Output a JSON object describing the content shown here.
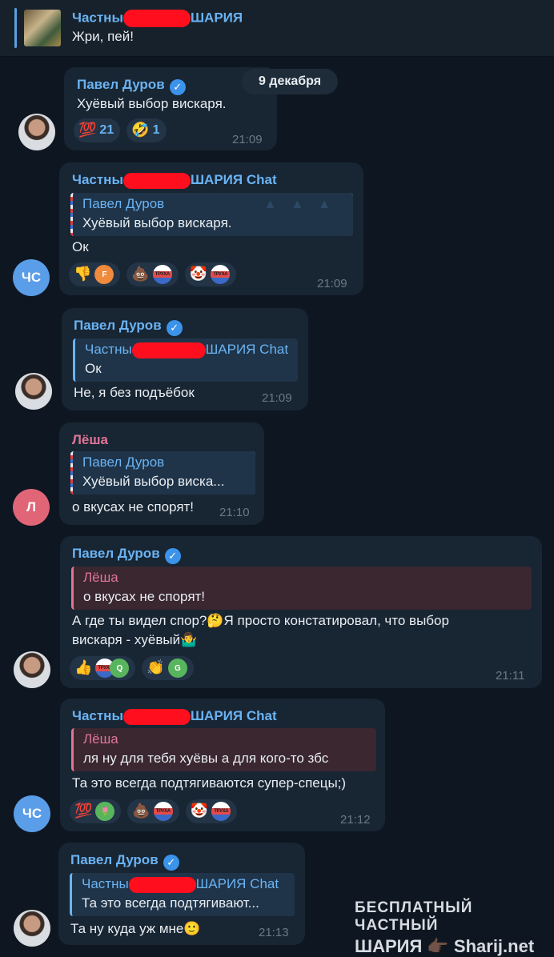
{
  "pinned": {
    "title_start": "Частны",
    "title_end": "ШАРИЯ",
    "text": "Жри, пей!"
  },
  "date_separator": "9 декабря",
  "messages": [
    {
      "sender": "Павел Дуров",
      "text": "Хуёвый выбор вискаря.",
      "time": "21:09",
      "reactions": [
        {
          "emoji": "💯",
          "count": "21"
        },
        {
          "emoji": "🤣",
          "count": "1"
        }
      ]
    },
    {
      "sender_start": "Частны",
      "sender_end": "ШАРИЯ Chat",
      "avatar": "ЧС",
      "reply_name": "Павел Дуров",
      "reply_text": "Хуёвый выбор вискаря.",
      "text": "Ок",
      "time": "21:09",
      "reactions": [
        {
          "emoji": "👎",
          "badge": "F"
        },
        {
          "emoji": "💩",
          "badge": "ТРУХА"
        },
        {
          "emoji": "🤡",
          "badge": "ТРУХА"
        }
      ]
    },
    {
      "sender": "Павел Дуров",
      "reply_name_start": "Частны",
      "reply_name_end": "ШАРИЯ Chat",
      "reply_text": "Ок",
      "text": "Не, я без подъёбок",
      "time": "21:09"
    },
    {
      "sender": "Лёша",
      "avatar": "Л",
      "reply_name": "Павел Дуров",
      "reply_text": "Хуёвый выбор виска...",
      "text": "о вкусах не спорят!",
      "time": "21:10"
    },
    {
      "sender": "Павел Дуров",
      "reply_name": "Лёша",
      "reply_text": "о вкусах не спорят!",
      "text_line1": "А где ты видел спор?🤔Я просто констатировал, что выбор",
      "text_line2": "вискаря - хуёвый🤷‍♂️",
      "time": "21:11",
      "reactions": [
        {
          "emoji": "👍",
          "badge": "ТРУХА",
          "badge2": "Q"
        },
        {
          "emoji": "👏",
          "badge": "G"
        }
      ]
    },
    {
      "sender_start": "Частны",
      "sender_end": "ШАРИЯ Chat",
      "avatar": "ЧС",
      "reply_name": "Лёша",
      "reply_text": "ля ну для тебя хуёвы а для кого-то збс",
      "text": "Та это всегда подтягиваются супер-спецы;)",
      "time": "21:12",
      "reactions": [
        {
          "emoji": "💯",
          "badge": "🌷"
        },
        {
          "emoji": "💩",
          "badge": "ТРУХА"
        },
        {
          "emoji": "🤡",
          "badge": "ТРУХА"
        }
      ]
    },
    {
      "sender": "Павел Дуров",
      "reply_name_start": "Частны",
      "reply_name_end": "ШАРИЯ Chat",
      "reply_text": "Та это всегда подтягивают...",
      "text": "Та ну куда уж мне🙂",
      "time": "21:13"
    }
  ],
  "watermark": {
    "line1": "БЕСПЛАТНЫЙ ЧАСТНЫЙ",
    "line2": "ШАРИЯ 👉🏿 Sharij.net"
  }
}
